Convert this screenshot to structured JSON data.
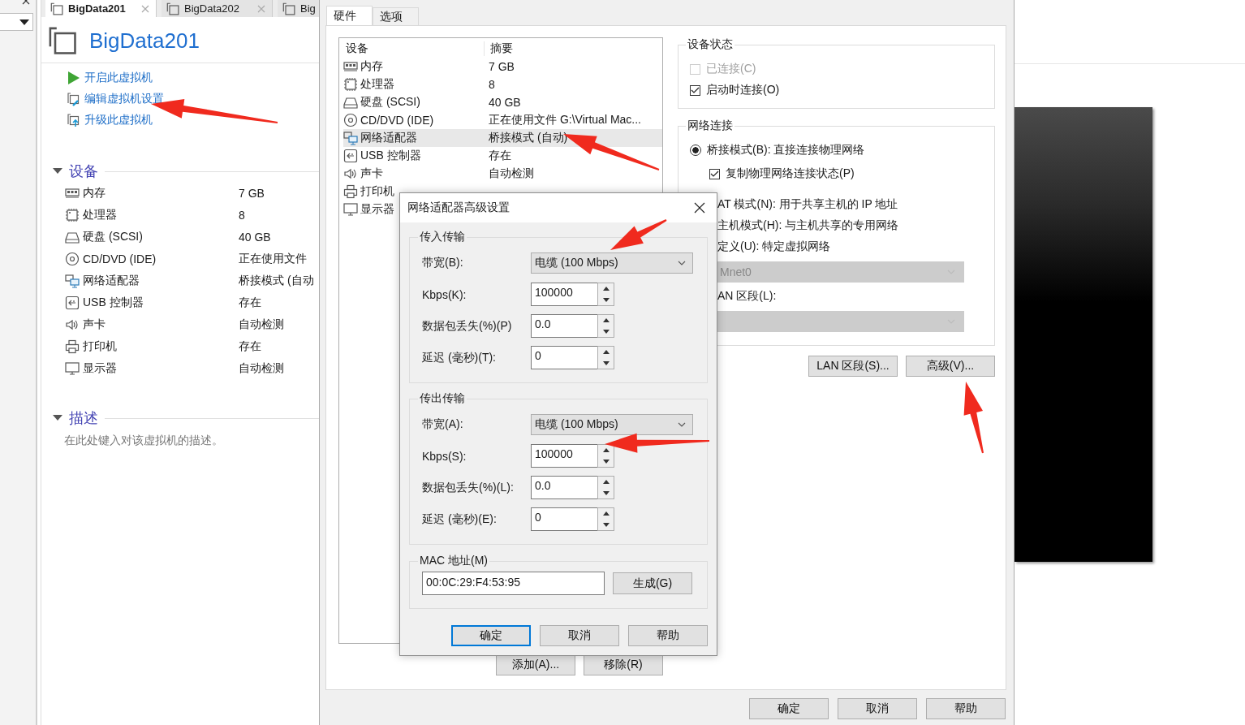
{
  "vm_tabs": [
    {
      "label": "BigData201",
      "selected": true
    },
    {
      "label": "BigData202",
      "selected": false
    },
    {
      "label": "Big",
      "selected": false
    }
  ],
  "vm_title": "BigData201",
  "actions": [
    {
      "kind": "power_on",
      "label": "开启此虚拟机"
    },
    {
      "kind": "edit",
      "label": "编辑虚拟机设置"
    },
    {
      "kind": "upgrade",
      "label": "升级此虚拟机"
    }
  ],
  "devices_section": {
    "title": "设备",
    "expanded": true,
    "items": [
      {
        "kind": "memory",
        "name": "内存",
        "value": "7 GB"
      },
      {
        "kind": "cpu",
        "name": "处理器",
        "value": "8"
      },
      {
        "kind": "disk",
        "name": "硬盘 (SCSI)",
        "value": "40 GB"
      },
      {
        "kind": "optical",
        "name": "CD/DVD (IDE)",
        "value": "正在使用文件"
      },
      {
        "kind": "network",
        "name": "网络适配器",
        "value": "桥接模式 (自动"
      },
      {
        "kind": "usb",
        "name": "USB 控制器",
        "value": "存在"
      },
      {
        "kind": "sound",
        "name": "声卡",
        "value": "自动检测"
      },
      {
        "kind": "printer",
        "name": "打印机",
        "value": "存在"
      },
      {
        "kind": "display",
        "name": "显示器",
        "value": "自动检测"
      }
    ]
  },
  "description_section": {
    "title": "描述",
    "expanded": true,
    "text": "在此处键入对该虚拟机的描述。"
  },
  "settings_dialog": {
    "tabs": [
      {
        "label": "硬件",
        "selected": true
      },
      {
        "label": "选项",
        "selected": false
      }
    ],
    "columns": [
      "设备",
      "摘要"
    ],
    "devices": [
      {
        "kind": "memory",
        "name": "内存",
        "summary": "7 GB",
        "selected": false
      },
      {
        "kind": "cpu",
        "name": "处理器",
        "summary": "8",
        "selected": false
      },
      {
        "kind": "disk",
        "name": "硬盘 (SCSI)",
        "summary": "40 GB",
        "selected": false
      },
      {
        "kind": "optical",
        "name": "CD/DVD (IDE)",
        "summary": "正在使用文件 G:\\Virtual Mac...",
        "selected": false
      },
      {
        "kind": "network",
        "name": "网络适配器",
        "summary": "桥接模式 (自动)",
        "selected": true
      },
      {
        "kind": "usb",
        "name": "USB 控制器",
        "summary": "存在",
        "selected": false
      },
      {
        "kind": "sound",
        "name": "声卡",
        "summary": "自动检测",
        "selected": false
      },
      {
        "kind": "printer",
        "name": "打印机",
        "selected": false
      },
      {
        "kind": "display",
        "name": "显示器",
        "selected": false
      }
    ],
    "list_buttons": [
      "添加(A)...",
      "移除(R)"
    ],
    "device_status": {
      "title": "设备状态",
      "items": [
        {
          "label": "已连接(C)",
          "checked": false,
          "disabled": true
        },
        {
          "label": "启动时连接(O)",
          "checked": true,
          "disabled": false
        }
      ]
    },
    "network_connection": {
      "title": "网络连接",
      "items": [
        {
          "kind": "radio",
          "label": "桥接模式(B): 直接连接物理网络",
          "selected": true
        },
        {
          "kind": "checkbox",
          "label": "复制物理网络连接状态(P)",
          "checked": true
        },
        {
          "kind": "text",
          "label": "AT 模式(N): 用于共享主机的 IP 地址"
        },
        {
          "kind": "text",
          "label": "主机模式(H): 与主机共享的专用网络"
        },
        {
          "kind": "text",
          "label": "定义(U): 特定虚拟网络"
        },
        {
          "kind": "dropdown",
          "value": "Mnet0",
          "disabled": true
        },
        {
          "kind": "text",
          "label": "AN 区段(L):"
        },
        {
          "kind": "dropdown",
          "disabled": true
        }
      ]
    },
    "network_buttons": [
      "LAN 区段(S)...",
      "高级(V)..."
    ],
    "buttons": [
      "确定",
      "取消",
      "帮助"
    ]
  },
  "advanced_dialog": {
    "title": "网络适配器高级设置",
    "groups": [
      {
        "title": "传入传输",
        "rows": [
          {
            "kind": "dropdown",
            "label": "带宽(B):",
            "value": "电缆 (100 Mbps)"
          },
          {
            "kind": "spinner",
            "label": "Kbps(K):",
            "value": "100000"
          },
          {
            "kind": "spinner",
            "label": "数据包丢失(%)(P)",
            "value": "0.0"
          },
          {
            "kind": "spinner",
            "label": "延迟 (毫秒)(T):",
            "value": "0"
          }
        ]
      },
      {
        "title": "传出传输",
        "rows": [
          {
            "kind": "dropdown",
            "label": "带宽(A):",
            "value": "电缆 (100 Mbps)"
          },
          {
            "kind": "spinner",
            "label": "Kbps(S):",
            "value": "100000"
          },
          {
            "kind": "spinner",
            "label": "数据包丢失(%)(L):",
            "value": "0.0"
          },
          {
            "kind": "spinner",
            "label": "延迟 (毫秒)(E):",
            "value": "0"
          }
        ]
      }
    ],
    "mac": {
      "title": "MAC 地址(M)",
      "value": "00:0C:29:F4:53:95",
      "button": "生成(G)"
    },
    "buttons": [
      {
        "label": "确定",
        "default": true
      },
      {
        "label": "取消",
        "default": false
      },
      {
        "label": "帮助",
        "default": false
      }
    ]
  }
}
